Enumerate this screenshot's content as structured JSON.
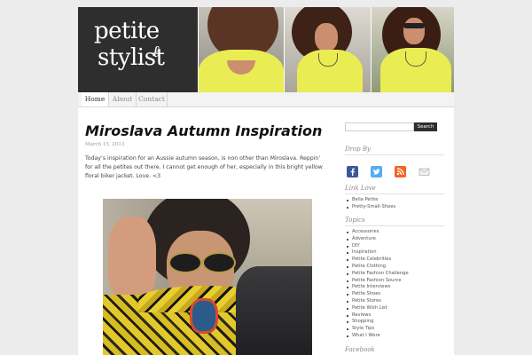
{
  "site": {
    "logo_line1": "petite",
    "logo_line2": "stylist"
  },
  "nav": {
    "tabs": [
      {
        "label": "Home",
        "active": true
      },
      {
        "label": "About",
        "active": false
      },
      {
        "label": "Contact",
        "active": false
      }
    ]
  },
  "post": {
    "title": "Miroslava Autumn Inspiration",
    "date": "March 15, 2013",
    "body": "Today’s inspiration for an Aussie autumn season, is non other than Miroslava. Reppin’ for all the petites out there. I cannot get enough of her, especially in this bright yellow floral biker jacket. Love. <3"
  },
  "sidebar": {
    "search_button": "Search",
    "search_placeholder": "",
    "drop_by_title": "Drop By",
    "drop_by_icons": [
      "facebook-icon",
      "twitter-icon",
      "rss-icon",
      "email-icon"
    ],
    "link_love_title": "Link Love",
    "link_love": [
      "Bella Petite",
      "Pretty-Small-Shoes"
    ],
    "topics_title": "Topics",
    "topics": [
      "Accessories",
      "Adventure",
      "DIY",
      "Inspiration",
      "Petite Celebrities",
      "Petite Clothing",
      "Petite Fashion Challenge",
      "Petite Fashion Source",
      "Petite Interviews",
      "Petite Shoes",
      "Petite Stores",
      "Petite Wish List",
      "Reviews",
      "Shopping",
      "Style Tips",
      "What I Wore"
    ],
    "facebook_title": "Facebook"
  },
  "colors": {
    "page_bg": "#ececec",
    "header_dark": "#2e2e2e",
    "shirt_yellow": "#eaec53",
    "facebook_blue": "#3b5998",
    "twitter_blue": "#55acee",
    "rss_orange": "#f26522"
  }
}
